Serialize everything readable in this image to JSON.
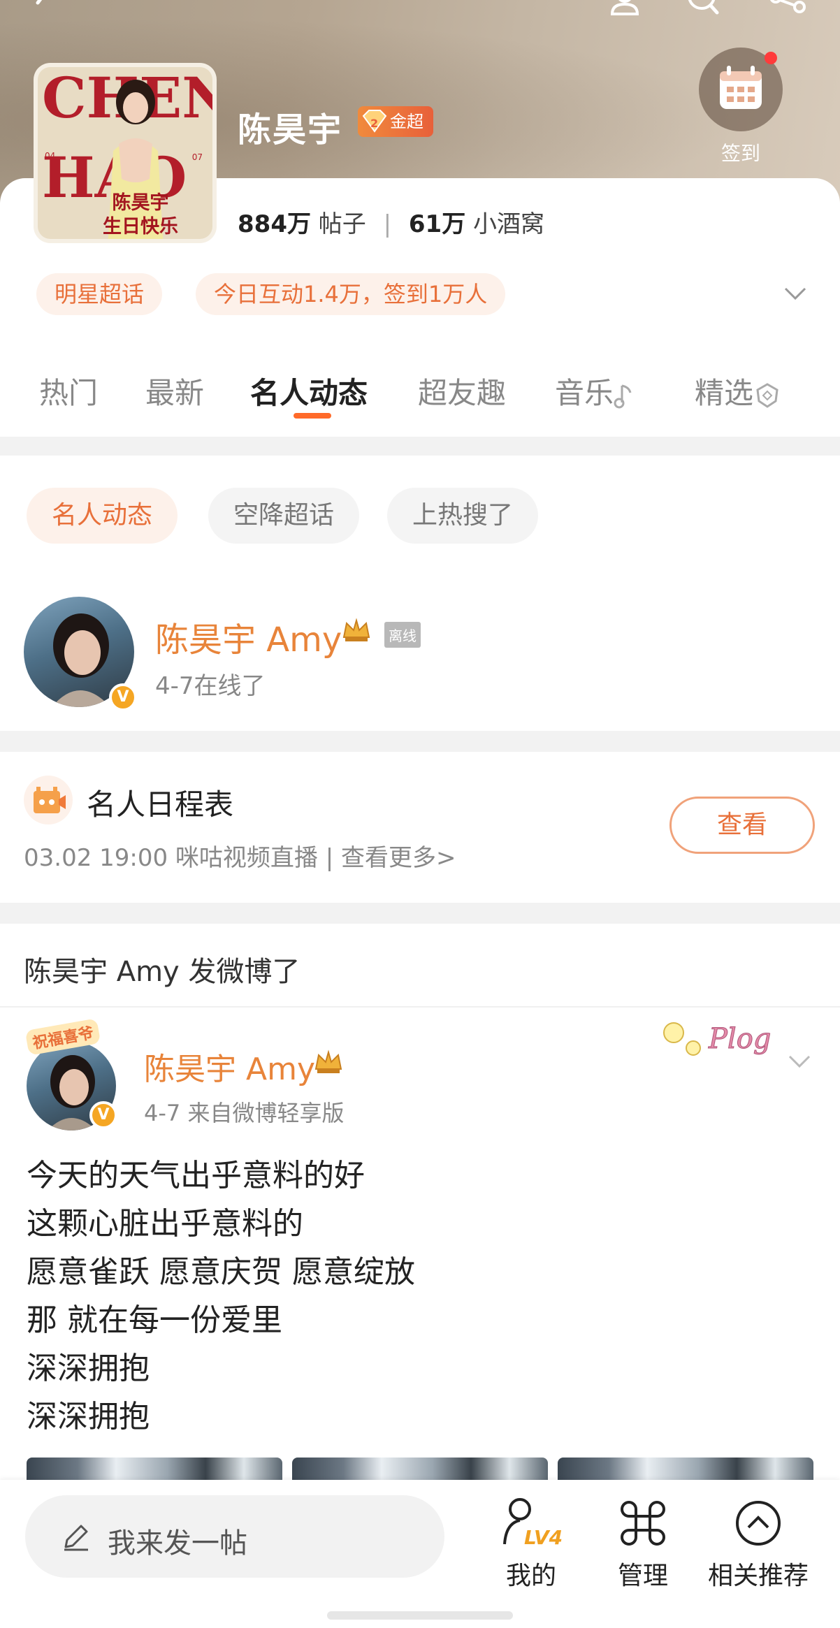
{
  "header": {
    "title": "陈昊宇",
    "badge_level": "2",
    "badge_label": "金超",
    "checkin_label": "签到",
    "cover": {
      "letters_top": "CHEN",
      "letters_bottom": "HAO",
      "caption_line1": "陈昊宇",
      "caption_line2": "生日快乐",
      "tag_left": "04",
      "tag_right": "07"
    },
    "stats": {
      "posts_value": "884万",
      "posts_label": "帖子",
      "fans_value": "61万",
      "fans_label": "小酒窝"
    },
    "chips": [
      "明星超话",
      "今日互动1.4万，签到1万人"
    ]
  },
  "tabs": [
    {
      "label": "热门",
      "active": false
    },
    {
      "label": "最新",
      "active": false
    },
    {
      "label": "名人动态",
      "active": true
    },
    {
      "label": "超友趣",
      "active": false
    },
    {
      "label": "音乐",
      "active": false
    },
    {
      "label": "精选",
      "active": false
    }
  ],
  "filters": [
    "名人动态",
    "空降超话",
    "上热搜了"
  ],
  "celebrity": {
    "name": "陈昊宇 Amy",
    "status_badge": "离线",
    "online_text": "4-7在线了",
    "verified_mark": "V"
  },
  "schedule": {
    "title": "名人日程表",
    "subtitle": "03.02 19:00 咪咕视频直播 |  查看更多>",
    "button": "查看"
  },
  "feed": {
    "section_title": "陈昊宇 Amy 发微博了",
    "post": {
      "avatar_badge": "祝福喜爷",
      "author": "陈昊宇 Amy",
      "meta": "4-7  来自微博轻享版",
      "sticker": "Plog",
      "lines": [
        "今天的天气出乎意料的好",
        "这颗心脏出乎意料的",
        "愿意雀跃 愿意庆贺 愿意绽放",
        "那 就在每一份爱里",
        "深深拥抱",
        "深深拥抱"
      ]
    }
  },
  "bottom_bar": {
    "compose_placeholder": "我来发一帖",
    "mine_label": "我的",
    "mine_level": "LV4",
    "manage_label": "管理",
    "related_label": "相关推荐"
  },
  "colors": {
    "accent": "#e8703a",
    "tab_underline": "#ff6a2a",
    "chip_bg": "#fdf1ea",
    "gap_bg": "#f2f2f2"
  }
}
